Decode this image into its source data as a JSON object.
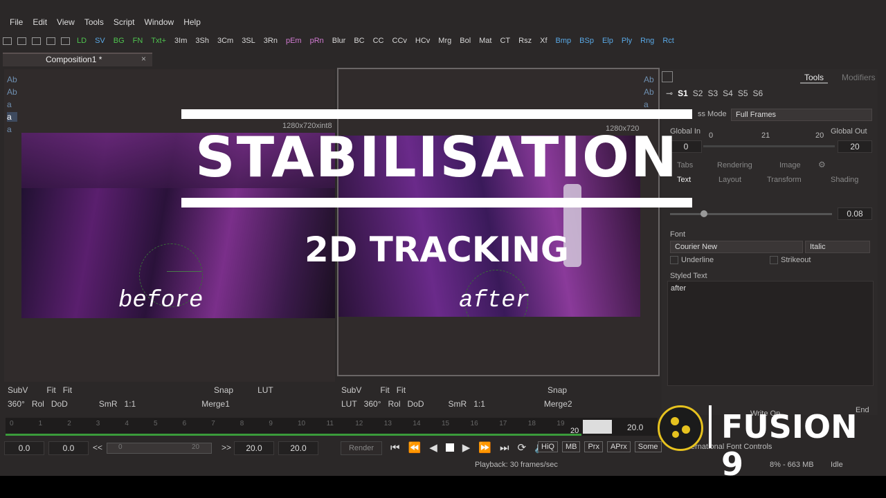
{
  "menu": [
    "File",
    "Edit",
    "View",
    "Tools",
    "Script",
    "Window",
    "Help"
  ],
  "toolbar": {
    "items": [
      {
        "label": "LD",
        "color": "#4fc44f"
      },
      {
        "label": "SV",
        "color": "#5aa9e6"
      },
      {
        "label": "BG",
        "color": "#4fc44f"
      },
      {
        "label": "FN",
        "color": "#4fc44f"
      },
      {
        "label": "Txt+",
        "color": "#4fc44f"
      },
      {
        "label": "3Im",
        "color": "#d8d8d8"
      },
      {
        "label": "3Sh",
        "color": "#d8d8d8"
      },
      {
        "label": "3Cm",
        "color": "#d8d8d8"
      },
      {
        "label": "3SL",
        "color": "#d8d8d8"
      },
      {
        "label": "3Rn",
        "color": "#d8d8d8"
      },
      {
        "label": "pEm",
        "color": "#d07ad0"
      },
      {
        "label": "pRn",
        "color": "#d07ad0"
      },
      {
        "label": "Blur",
        "color": "#d8d8d8"
      },
      {
        "label": "BC",
        "color": "#d8d8d8"
      },
      {
        "label": "CC",
        "color": "#d8d8d8"
      },
      {
        "label": "CCv",
        "color": "#d8d8d8"
      },
      {
        "label": "HCv",
        "color": "#d8d8d8"
      },
      {
        "label": "Mrg",
        "color": "#d8d8d8"
      },
      {
        "label": "Bol",
        "color": "#d8d8d8"
      },
      {
        "label": "Mat",
        "color": "#d8d8d8"
      },
      {
        "label": "CT",
        "color": "#d8d8d8"
      },
      {
        "label": "Rsz",
        "color": "#d8d8d8"
      },
      {
        "label": "Xf",
        "color": "#d8d8d8"
      },
      {
        "label": "Bmp",
        "color": "#5aa9e6"
      },
      {
        "label": "BSp",
        "color": "#5aa9e6"
      },
      {
        "label": "Elp",
        "color": "#5aa9e6"
      },
      {
        "label": "Ply",
        "color": "#5aa9e6"
      },
      {
        "label": "Rng",
        "color": "#5aa9e6"
      },
      {
        "label": "Rct",
        "color": "#5aa9e6"
      }
    ]
  },
  "composition_tab": {
    "label": "Composition1 *",
    "close": "×"
  },
  "viewer_left": {
    "res": "1280x720xint8",
    "caption": "before",
    "chips": [
      "Ab",
      "Ab",
      "a",
      "a",
      "a"
    ],
    "row1": [
      "SubV",
      "Fit",
      "Fit",
      "Snap",
      "LUT"
    ],
    "row2": [
      "360°",
      "Rol",
      "DoD",
      "SmR",
      "1:1"
    ],
    "name": "Merge1"
  },
  "viewer_right": {
    "res": "1280x720",
    "caption": "after",
    "chips": [
      "Ab",
      "Ab",
      "a"
    ],
    "row1": [
      "SubV",
      "Fit",
      "Fit",
      "Snap"
    ],
    "row2": [
      "LUT",
      "360°",
      "Rol",
      "DoD",
      "SmR",
      "1:1"
    ],
    "name": "Merge2"
  },
  "overlay": {
    "title": "STABILISATION",
    "subtitle": "2D TRACKING"
  },
  "timeline": {
    "ticks": [
      "0",
      "1",
      "2",
      "3",
      "4",
      "5",
      "6",
      "7",
      "8",
      "9",
      "10",
      "11",
      "12",
      "13",
      "14",
      "15",
      "16",
      "17",
      "18",
      "19",
      "20"
    ],
    "end_value": "20.0",
    "current": "20",
    "f1": "0.0",
    "f2": "0.0",
    "lt": "<<",
    "range_start": "0",
    "range_end": "20",
    "gt": ">>",
    "f3": "20.0",
    "f4": "20.0",
    "render": "Render",
    "buttons": [
      "HiQ",
      "MB",
      "Prx",
      "APrx",
      "Some"
    ]
  },
  "status": {
    "playback": "Playback: 30 frames/sec",
    "memory": "8% -  663 MB",
    "state": "Idle"
  },
  "panel": {
    "tabs": [
      "Tools",
      "Modifiers"
    ],
    "slots": [
      "S1",
      "S2",
      "S3",
      "S4",
      "S5",
      "S6"
    ],
    "process_mode_label": "ss Mode",
    "process_mode": "Full Frames",
    "global_in_label": "Global In",
    "global_out_label": "Global Out",
    "global_in": "0",
    "global_out": "20",
    "ruler_a": "0",
    "ruler_b": "21",
    "ruler_c": "20",
    "subtabs1": [
      "Tabs",
      "Rendering",
      "Image"
    ],
    "subtabs2": [
      "Text",
      "Layout",
      "Transform",
      "Shading"
    ],
    "size_value": "0.08",
    "font_label": "Font",
    "font": "Courier New",
    "style": "Italic",
    "underline": "Underline",
    "strikeout": "Strikeout",
    "styled_text_label": "Styled Text",
    "styled_text": "after",
    "write_on": "Write On",
    "end_label": "End",
    "intl": "ernational Font Controls"
  },
  "logo": {
    "text": "FUSION 9"
  }
}
